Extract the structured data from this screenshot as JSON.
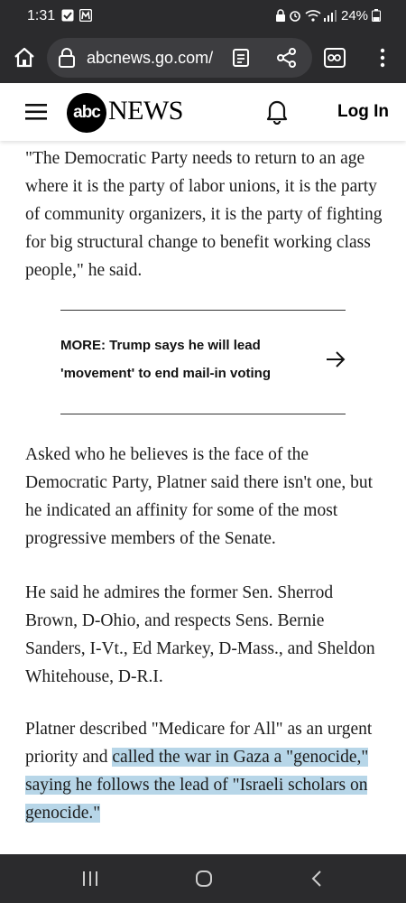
{
  "status_bar": {
    "time": "1:31",
    "battery": "24%"
  },
  "browser": {
    "url": "abcnews.go.com/"
  },
  "site": {
    "logo_abc": "abc",
    "logo_news": "NEWS",
    "login": "Log In"
  },
  "article": {
    "p1": "\"The Democratic Party needs to return to an age where it is the party of labor unions, it is the party of community organizers, it is the party of fighting for big structural change to benefit working class people,\" he said.",
    "more_prefix": "MORE:",
    "more_text": " Trump says he will lead 'movement' to end mail-in voting",
    "p2": "Asked who he believes is the face of the Democratic Party, Platner said there isn't one, but he indicated an affinity for some of the most progressive members of the Senate.",
    "p3": "He said he admires the former Sen. Sherrod Brown, D-Ohio, and respects Sens. Bernie Sanders, I-Vt., Ed Markey, D-Mass., and Sheldon Whitehouse, D-R.I.",
    "p4_plain": "Platner described \"Medicare for All\" as an urgent priority and ",
    "p4_highlight": "called the war in Gaza a \"genocide,\" saying he follows the lead of \"Israeli scholars on genocide.\""
  },
  "colors": {
    "highlight": "#b7d6e8",
    "chrome": "#2b2b2d"
  }
}
